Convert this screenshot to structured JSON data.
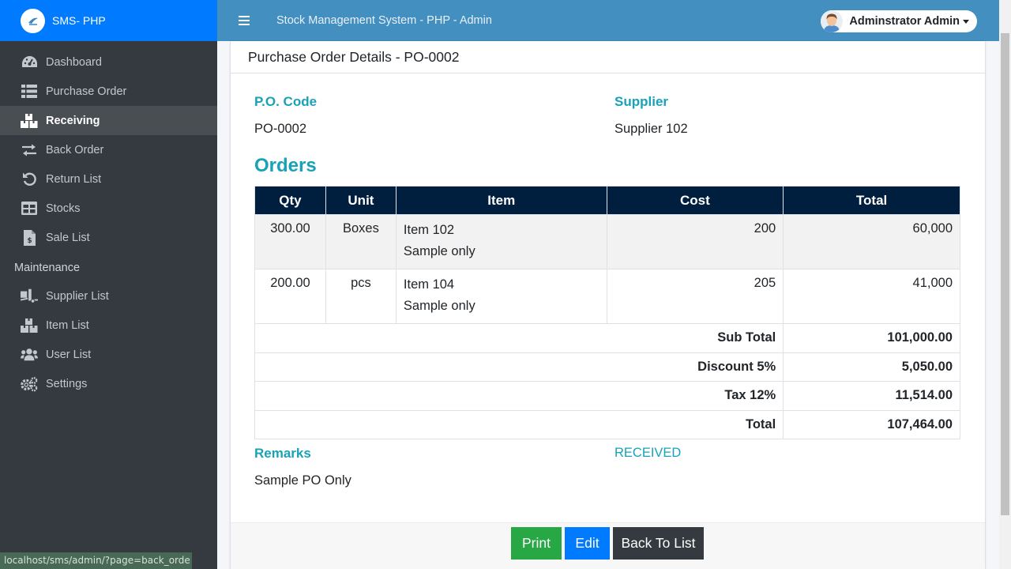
{
  "brand": {
    "name": "SMS- PHP"
  },
  "topbar": {
    "title": "Stock Management System - PHP - Admin",
    "user_name": "Adminstrator Admin"
  },
  "sidebar": {
    "items": [
      {
        "label": "Dashboard",
        "icon": "dashboard-icon",
        "active": false
      },
      {
        "label": "Purchase Order",
        "icon": "list-icon",
        "active": false
      },
      {
        "label": "Receiving",
        "icon": "boxes-icon",
        "active": true
      },
      {
        "label": "Back Order",
        "icon": "exchange-icon",
        "active": false
      },
      {
        "label": "Return List",
        "icon": "undo-icon",
        "active": false
      },
      {
        "label": "Stocks",
        "icon": "table-icon",
        "active": false
      },
      {
        "label": "Sale List",
        "icon": "invoice-icon",
        "active": false
      }
    ],
    "section_header": "Maintenance",
    "maintenance_items": [
      {
        "label": "Supplier List",
        "icon": "truck-loading-icon"
      },
      {
        "label": "Item List",
        "icon": "boxes-icon"
      },
      {
        "label": "User List",
        "icon": "users-icon"
      },
      {
        "label": "Settings",
        "icon": "cogs-icon"
      }
    ]
  },
  "card": {
    "title": "Purchase Order Details - PO-0002",
    "po_code_label": "P.O. Code",
    "po_code": "PO-0002",
    "supplier_label": "Supplier",
    "supplier": "Supplier 102",
    "orders_heading": "Orders",
    "table": {
      "headers": [
        "Qty",
        "Unit",
        "Item",
        "Cost",
        "Total"
      ],
      "rows": [
        {
          "qty": "300.00",
          "unit": "Boxes",
          "item": "Item 102",
          "desc": "Sample only",
          "cost": "200",
          "total": "60,000"
        },
        {
          "qty": "200.00",
          "unit": "pcs",
          "item": "Item 104",
          "desc": "Sample only",
          "cost": "205",
          "total": "41,000"
        }
      ],
      "summary": [
        {
          "label": "Sub Total",
          "value": "101,000.00"
        },
        {
          "label": "Discount 5%",
          "value": "5,050.00"
        },
        {
          "label": "Tax 12%",
          "value": "11,514.00"
        },
        {
          "label": "Total",
          "value": "107,464.00"
        }
      ]
    },
    "remarks_label": "Remarks",
    "remarks": "Sample PO Only",
    "status": "RECEIVED",
    "buttons": {
      "print": "Print",
      "edit": "Edit",
      "back": "Back To List"
    }
  },
  "browser_status_url": "localhost/sms/admin/?page=back_orde",
  "colors": {
    "brand": "#007bff",
    "navbar": "#428fc0",
    "sidebar": "#343a40",
    "accent": "#17a2b8",
    "table_header": "#001f3f"
  }
}
